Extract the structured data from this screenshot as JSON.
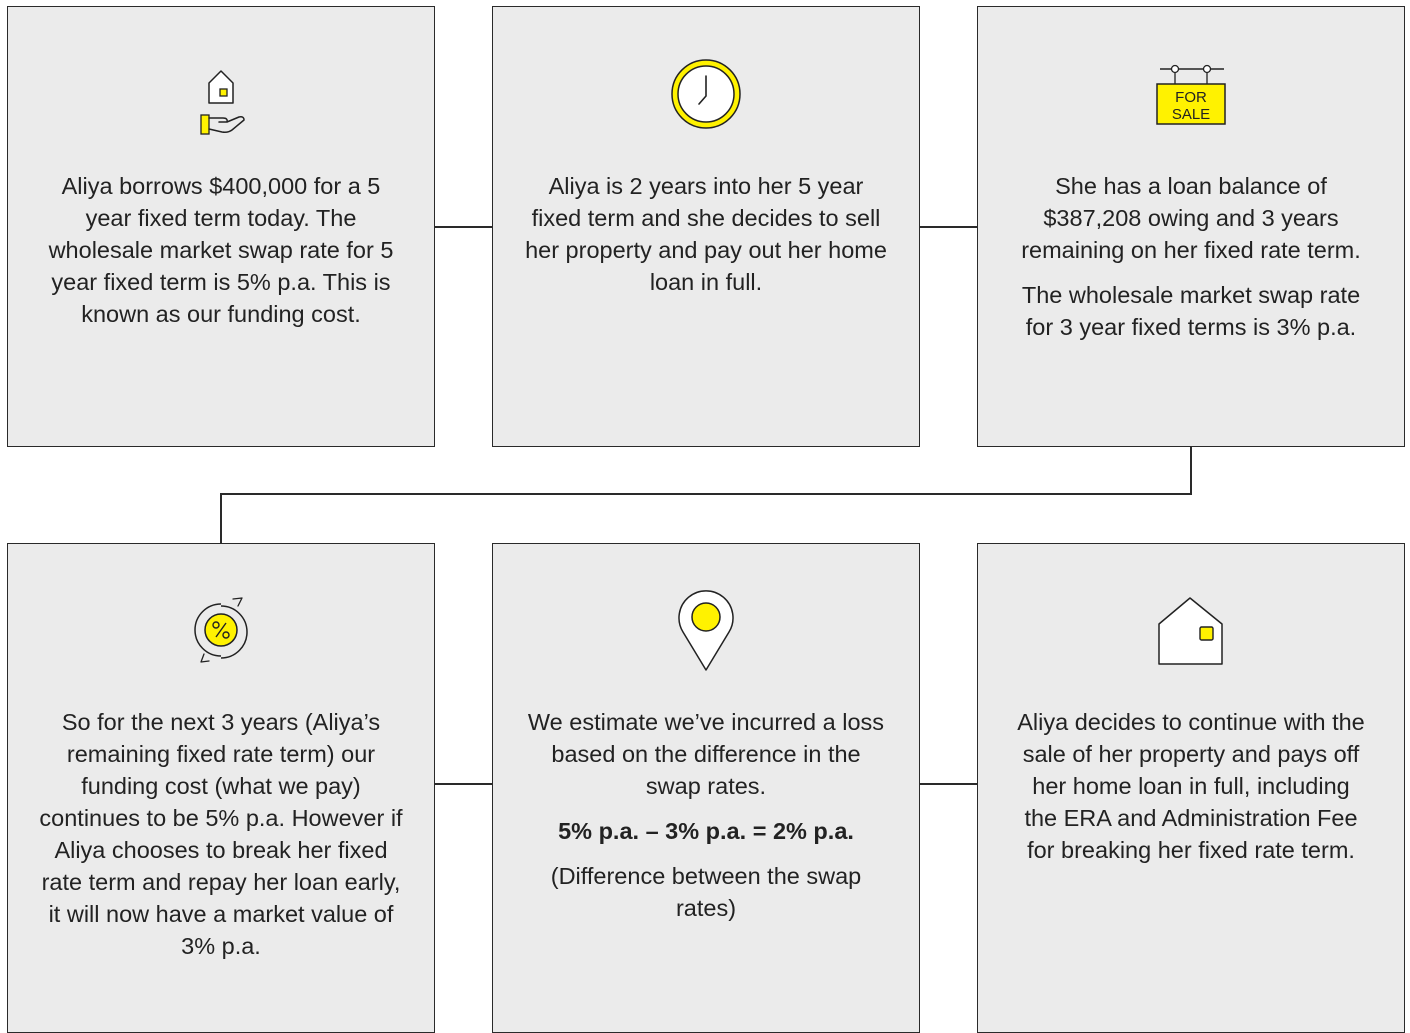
{
  "steps": [
    {
      "icon": "hand-house-icon",
      "paragraphs": [
        "Aliya borrows $400,000 for a 5 year fixed term today. The wholesale market swap rate for 5 year fixed term is 5% p.a. This is known as our funding cost."
      ]
    },
    {
      "icon": "clock-icon",
      "paragraphs": [
        "Aliya is 2 years into her 5 year fixed term and she decides to sell her property and pay out her home loan in full."
      ]
    },
    {
      "icon": "for-sale-sign-icon",
      "sign_text": [
        "FOR",
        "SALE"
      ],
      "paragraphs": [
        "She has a loan balance of $387,208 owing and 3 years remaining on her fixed rate term.",
        "The wholesale market swap rate for 3 year fixed terms is 3% p.a."
      ]
    },
    {
      "icon": "percent-cycle-icon",
      "paragraphs": [
        "So for the next 3 years (Aliya’s remaining fixed rate term) our funding cost (what we pay) continues to be 5% p.a. However if Aliya chooses to break her fixed rate term and repay her loan early, it will now have a market value of 3% p.a."
      ]
    },
    {
      "icon": "location-pin-icon",
      "paragraphs": [
        "We estimate we’ve incurred a loss based on the difference in the swap rates.",
        "5% p.a. – 3% p.a. = 2% p.a.",
        "(Difference between the swap rates)"
      ]
    },
    {
      "icon": "house-icon",
      "paragraphs": [
        "Aliya decides to continue with the sale of her property and pays off her home loan in full, including the ERA and Administration Fee for breaking her fixed rate term."
      ]
    }
  ],
  "colors": {
    "accent": "#fff200",
    "card_bg": "#ebebeb",
    "border": "#2a2a2a",
    "text": "#222222"
  }
}
